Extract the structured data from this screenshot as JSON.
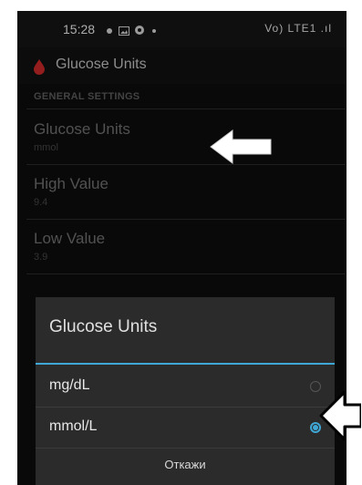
{
  "statusbar": {
    "time": "15:28",
    "right_text": "Vo) LTE1 .ıl"
  },
  "appbar": {
    "title": "Glucose Units",
    "accent": "#c62828"
  },
  "settings": {
    "section_header": "GENERAL SETTINGS",
    "items": [
      {
        "title": "Glucose Units",
        "value": "mmol"
      },
      {
        "title": "High Value",
        "value": "9.4"
      },
      {
        "title": "Low Value",
        "value": "3.9"
      }
    ]
  },
  "dialog": {
    "title": "Glucose Units",
    "options": [
      {
        "label": "mg/dL",
        "selected": false
      },
      {
        "label": "mmol/L",
        "selected": true
      }
    ],
    "cancel_label": "Откажи",
    "accent": "#3fa7d6"
  },
  "annotations": {
    "arrow_icons": [
      "white-arrow-left-icon",
      "white-arrow-left-icon"
    ]
  }
}
